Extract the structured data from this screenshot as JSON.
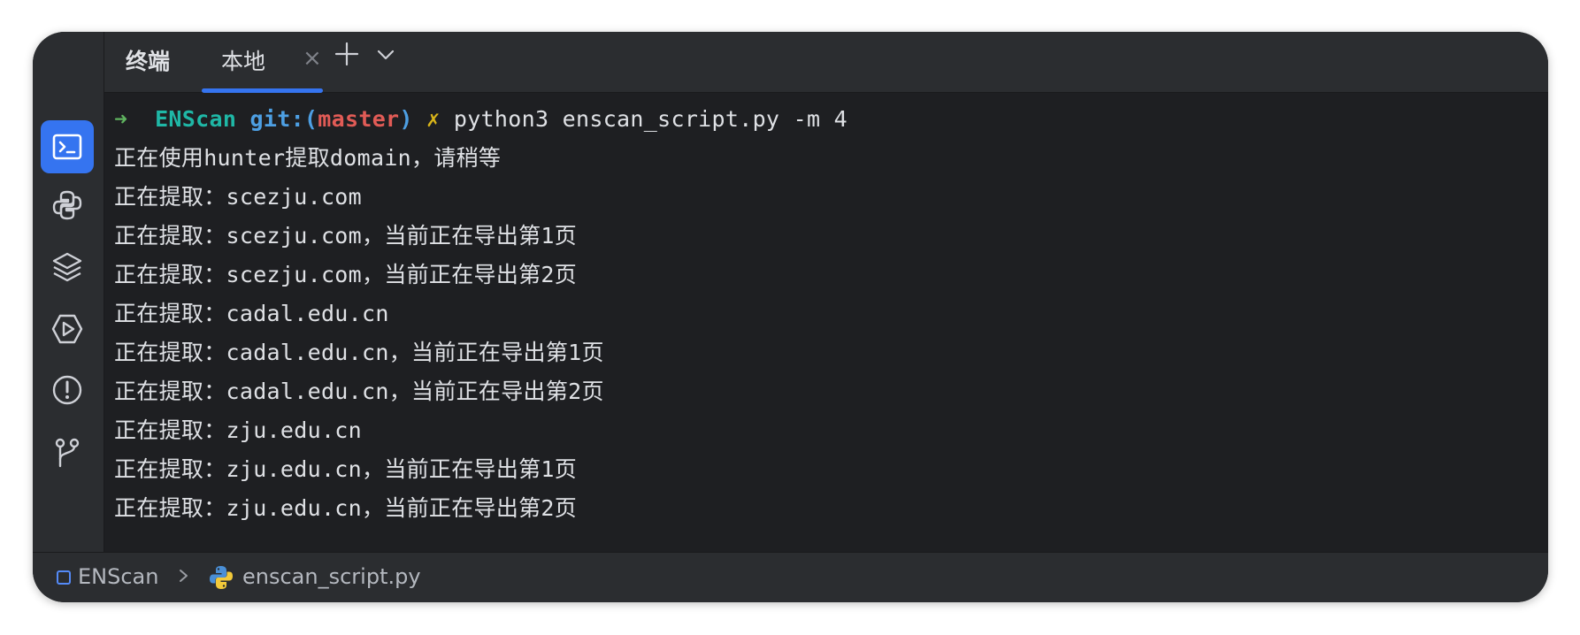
{
  "tabs": {
    "title": "终端",
    "active_tab": "本地",
    "close_glyph": "×"
  },
  "sidebar": {
    "items": [
      {
        "icon": "terminal-icon",
        "active": true
      },
      {
        "icon": "python-console-icon",
        "active": false
      },
      {
        "icon": "layers-icon",
        "active": false
      },
      {
        "icon": "run-icon",
        "active": false
      },
      {
        "icon": "problems-icon",
        "active": false
      },
      {
        "icon": "git-branch-icon",
        "active": false
      }
    ]
  },
  "terminal": {
    "prompt": {
      "arrow": "➜",
      "dir": "ENScan",
      "git_prefix": "git:(",
      "branch": "master",
      "git_suffix": ")",
      "dirty_mark": "✗",
      "command": "python3 enscan_script.py -m 4"
    },
    "lines": [
      "正在使用hunter提取domain，请稍等",
      "正在提取：scezju.com",
      "正在提取：scezju.com，当前正在导出第1页",
      "正在提取：scezju.com，当前正在导出第2页",
      "正在提取：cadal.edu.cn",
      "正在提取：cadal.edu.cn，当前正在导出第1页",
      "正在提取：cadal.edu.cn，当前正在导出第2页",
      "正在提取：zju.edu.cn",
      "正在提取：zju.edu.cn，当前正在导出第1页",
      "正在提取：zju.edu.cn，当前正在导出第2页"
    ]
  },
  "statusbar": {
    "project": "ENScan",
    "file": "enscan_script.py"
  },
  "colors": {
    "accent": "#3574f0",
    "background": "#1e1f22",
    "panel": "#2b2d30"
  }
}
